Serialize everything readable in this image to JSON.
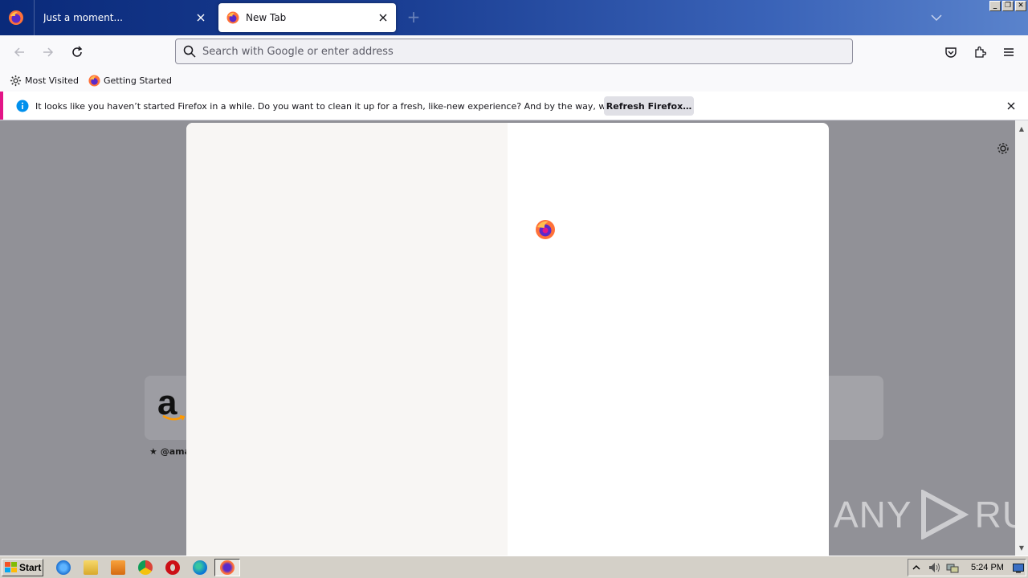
{
  "tabs": [
    {
      "label": "Just a moment...",
      "active": false
    },
    {
      "label": "New Tab",
      "active": true
    }
  ],
  "urlbar": {
    "placeholder": "Search with Google or enter address"
  },
  "bookmarks": [
    {
      "label": "Most Visited",
      "icon": "gear-icon"
    },
    {
      "label": "Getting Started",
      "icon": "firefox-icon"
    }
  ],
  "notification": {
    "message": "It looks like you haven’t started Firefox in a while. Do you want to clean it up for a fresh, like-new experience? And by the way, welcome back!",
    "button_label": "Refresh Firefox…"
  },
  "topsites": [
    {
      "label": "★ @ama",
      "logo_text": "a"
    }
  ],
  "watermark": {
    "left": "ANY",
    "right": "RUN"
  },
  "taskbar": {
    "start_label": "Start",
    "clock": "5:24 PM"
  },
  "colors": {
    "accent_bar": "#e31587",
    "info_blue": "#0090ed",
    "tabstrip": "#1b3f94"
  }
}
